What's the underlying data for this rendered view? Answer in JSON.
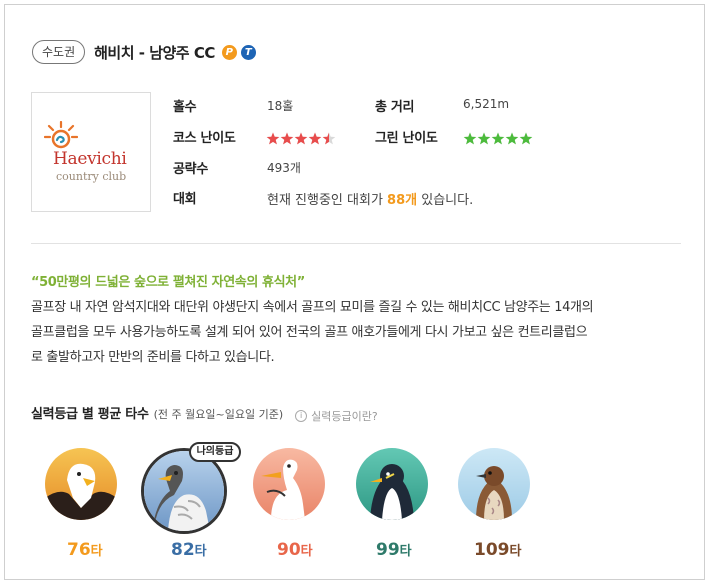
{
  "header": {
    "region": "수도권",
    "title": "해비치 - 남양주 CC",
    "badge_p": "P",
    "badge_t": "T"
  },
  "logo": {
    "name": "Haevichi",
    "sub": "country club"
  },
  "info": {
    "holes_label": "홀수",
    "holes_value": "18홀",
    "distance_label": "총 거리",
    "distance_value": "6,521m",
    "course_diff_label": "코스 난이도",
    "course_diff_rating": 4.5,
    "green_diff_label": "그린 난이도",
    "green_diff_rating": 5,
    "strategy_label": "공략수",
    "strategy_value": "493개",
    "tournament_label": "대회",
    "tournament_prefix": "현재 진행중인 대회가 ",
    "tournament_count": "88개",
    "tournament_suffix": " 있습니다."
  },
  "description": {
    "headline": "“50만평의 드넓은 숲으로 펼쳐진 자연속의 휴식처”",
    "lines": [
      "골프장 내 자연 암석지대와 대단위 야생단지 속에서 골프의 묘미를 즐길 수 있는 해비치CC 남양주는 14개의",
      "골프클럽을 모두 사용가능하도록 설계 되어 있어 전국의 골프 애호가들에게 다시 가보고 싶은 컨트리클럽으",
      "로 출발하고자 만반의 준비를 다하고 있습니다."
    ]
  },
  "grade": {
    "title": "실력등급 별 평균 타수",
    "period": "(전 주 월요일~일요일 기준)",
    "help": "실력등급이란?",
    "my_grade_label": "나의등급",
    "levels": [
      {
        "score": "76",
        "unit": "타",
        "color": "#f39a1d",
        "bird": "eagle"
      },
      {
        "score": "82",
        "unit": "타",
        "color": "#3a6ea5",
        "bird": "hawk",
        "mine": true
      },
      {
        "score": "90",
        "unit": "타",
        "color": "#e8664a",
        "bird": "heron"
      },
      {
        "score": "99",
        "unit": "타",
        "color": "#2e7a6a",
        "bird": "penguin"
      },
      {
        "score": "109",
        "unit": "타",
        "color": "#7a4a2a",
        "bird": "sparrow"
      }
    ]
  }
}
